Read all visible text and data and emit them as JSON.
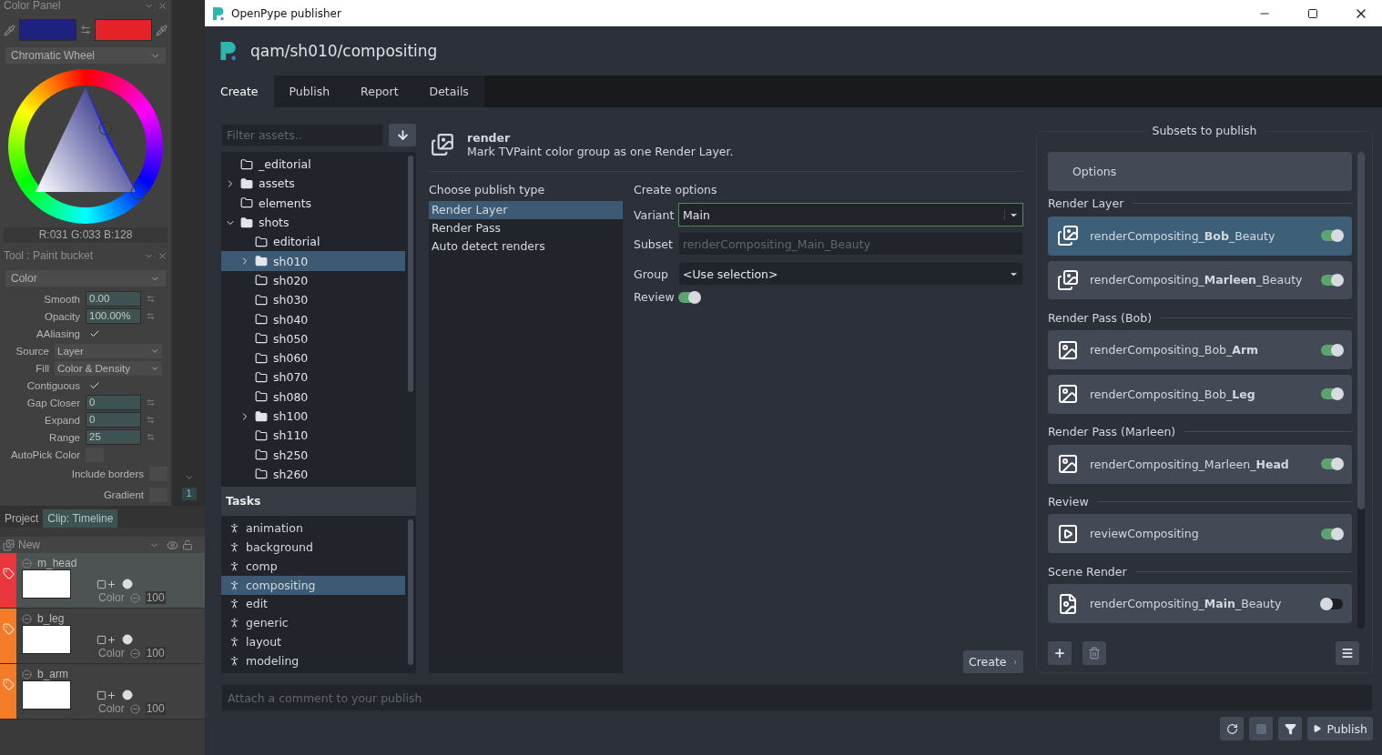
{
  "tvpaint": {
    "color_panel": {
      "title": "Color Panel",
      "wheel_mode": "Chromatic Wheel",
      "rgb": "R:031 G:033 B:128"
    },
    "tool_panel": {
      "title": "Tool : Paint bucket",
      "mode": "Color",
      "fields": [
        {
          "kind": "number",
          "label": "Smooth",
          "value": "0.00"
        },
        {
          "kind": "number",
          "label": "Opacity",
          "value": "100.00%"
        },
        {
          "kind": "check",
          "label": "AAliasing",
          "checked": true
        },
        {
          "kind": "select",
          "label": "Source",
          "value": "Layer"
        },
        {
          "kind": "select",
          "label": "Fill",
          "value": "Color & Density"
        },
        {
          "kind": "check",
          "label": "Contiguous",
          "checked": true
        },
        {
          "kind": "number",
          "label": "Gap Closer",
          "value": "0"
        },
        {
          "kind": "number",
          "label": "Expand",
          "value": "0"
        },
        {
          "kind": "number",
          "label": "Range",
          "value": "25"
        },
        {
          "kind": "check",
          "label": "AutoPick Color",
          "checked": false
        },
        {
          "kind": "wide_check",
          "label": "Include borders",
          "checked": false
        },
        {
          "kind": "wide_check",
          "label": "Gradient",
          "checked": false
        }
      ]
    },
    "frame_number": "1",
    "timeline": {
      "tabs": [
        {
          "label": "Project",
          "selected": false
        },
        {
          "label": "Clip: Timeline",
          "selected": true
        }
      ],
      "layer_menu": "New",
      "layers": [
        {
          "name": "m_head",
          "color": "#e8373d",
          "blend": "Color",
          "opacity": "100",
          "selected": true
        },
        {
          "name": "b_leg",
          "color": "#f47b28",
          "blend": "Color",
          "opacity": "100",
          "selected": false
        },
        {
          "name": "b_arm",
          "color": "#f47b28",
          "blend": "Color",
          "opacity": "100",
          "selected": false
        }
      ]
    }
  },
  "publisher": {
    "window_title": "OpenPype publisher",
    "context": "qam/sh010/compositing",
    "tabs": [
      {
        "label": "Create",
        "selected": true
      },
      {
        "label": "Publish",
        "selected": false
      },
      {
        "label": "Report",
        "selected": false
      },
      {
        "label": "Details",
        "selected": false
      }
    ],
    "asset_filter": {
      "placeholder": "Filter assets.."
    },
    "assets": [
      {
        "label": "_editorial",
        "kind": "leaf",
        "expanded": false,
        "selected": false
      },
      {
        "label": "assets",
        "kind": "branch",
        "expanded": false,
        "selected": false
      },
      {
        "label": "elements",
        "kind": "leaf",
        "expanded": false,
        "selected": false
      },
      {
        "label": "shots",
        "kind": "branch",
        "expanded": true,
        "selected": false,
        "children": [
          {
            "label": "editorial",
            "kind": "leaf",
            "expanded": false,
            "selected": false
          },
          {
            "label": "sh010",
            "kind": "branch",
            "expanded": false,
            "selected": true
          },
          {
            "label": "sh020",
            "kind": "leaf",
            "expanded": false,
            "selected": false
          },
          {
            "label": "sh030",
            "kind": "leaf",
            "expanded": false,
            "selected": false
          },
          {
            "label": "sh040",
            "kind": "leaf",
            "expanded": false,
            "selected": false
          },
          {
            "label": "sh050",
            "kind": "leaf",
            "expanded": false,
            "selected": false
          },
          {
            "label": "sh060",
            "kind": "leaf",
            "expanded": false,
            "selected": false
          },
          {
            "label": "sh070",
            "kind": "leaf",
            "expanded": false,
            "selected": false
          },
          {
            "label": "sh080",
            "kind": "leaf",
            "expanded": false,
            "selected": false
          },
          {
            "label": "sh100",
            "kind": "branch",
            "expanded": false,
            "selected": false
          },
          {
            "label": "sh110",
            "kind": "leaf",
            "expanded": false,
            "selected": false
          },
          {
            "label": "sh250",
            "kind": "leaf",
            "expanded": false,
            "selected": false
          },
          {
            "label": "sh260",
            "kind": "leaf",
            "expanded": false,
            "selected": false
          }
        ]
      }
    ],
    "tasks_header": "Tasks",
    "tasks": [
      {
        "label": "animation",
        "selected": false
      },
      {
        "label": "background",
        "selected": false
      },
      {
        "label": "comp",
        "selected": false
      },
      {
        "label": "compositing",
        "selected": true
      },
      {
        "label": "edit",
        "selected": false
      },
      {
        "label": "generic",
        "selected": false
      },
      {
        "label": "layout",
        "selected": false
      },
      {
        "label": "modeling",
        "selected": false
      }
    ],
    "creator": {
      "title": "render",
      "description": "Mark TVPaint color group as one Render Layer."
    },
    "publish_type_label": "Choose publish type",
    "publish_types": [
      {
        "label": "Render Layer",
        "selected": true
      },
      {
        "label": "Render Pass",
        "selected": false
      },
      {
        "label": "Auto detect renders",
        "selected": false
      }
    ],
    "create_options_label": "Create options",
    "variant": {
      "label": "Variant",
      "value": "Main"
    },
    "subset": {
      "label": "Subset",
      "value": "renderCompositing_Main_Beauty"
    },
    "group": {
      "label": "Group",
      "value": "<Use selection>"
    },
    "review": {
      "label": "Review",
      "on": true
    },
    "create_button": "Create",
    "subsets_title": "Subsets to publish",
    "options_button": "Options",
    "subset_groups": [
      {
        "label": "Render Layer",
        "items": [
          {
            "label": "renderCompositing_**Bob**_Beauty",
            "kind": "layer",
            "enabled": true,
            "selected": true
          },
          {
            "label": "renderCompositing_**Marleen**_Beauty",
            "kind": "layer",
            "enabled": true,
            "selected": false
          }
        ]
      },
      {
        "label": "Render Pass (Bob)",
        "items": [
          {
            "label": "renderCompositing_Bob_**Arm**",
            "kind": "pass",
            "enabled": true,
            "selected": false
          },
          {
            "label": "renderCompositing_Bob_**Leg**",
            "kind": "pass",
            "enabled": true,
            "selected": false
          }
        ]
      },
      {
        "label": "Render Pass (Marleen)",
        "items": [
          {
            "label": "renderCompositing_Marleen_**Head**",
            "kind": "pass",
            "enabled": true,
            "selected": false
          }
        ]
      },
      {
        "label": "Review",
        "items": [
          {
            "label": "reviewCompositing",
            "kind": "review",
            "enabled": true,
            "selected": false
          }
        ]
      },
      {
        "label": "Scene Render",
        "items": [
          {
            "label": "renderCompositing_**Main**_Beauty",
            "kind": "scene",
            "enabled": false,
            "selected": false
          }
        ]
      }
    ],
    "comment": {
      "placeholder": "Attach a comment to your publish"
    },
    "publish_button": "Publish"
  }
}
